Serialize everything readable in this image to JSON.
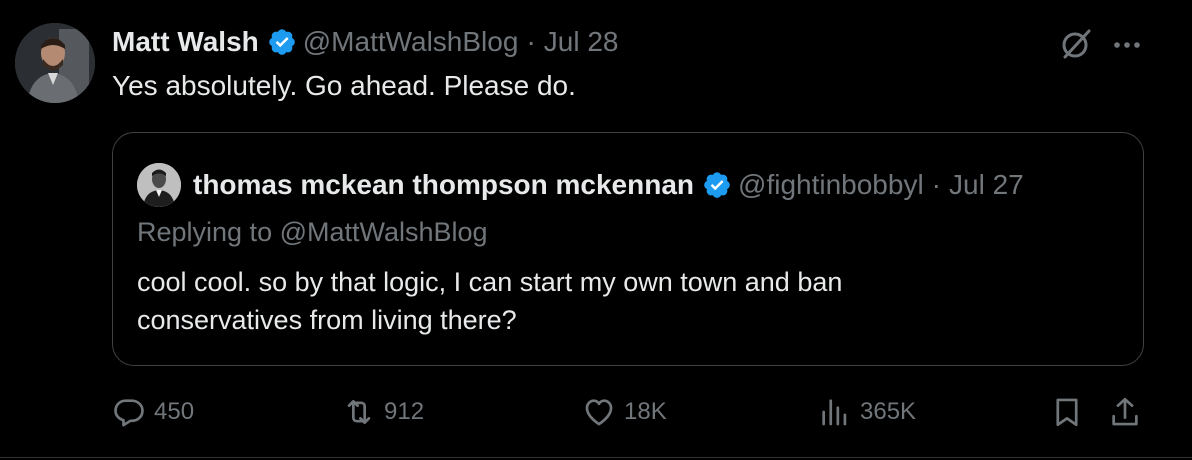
{
  "post": {
    "author_name": "Matt Walsh",
    "author_handle": "@MattWalshBlog",
    "separator": "·",
    "date": "Jul 28",
    "text": "Yes absolutely. Go ahead. Please do."
  },
  "quote": {
    "author_name": "thomas mckean thompson mckennan",
    "author_handle": "@fightinbobbyl",
    "separator": "·",
    "date": "Jul 27",
    "replying_to": "Replying to @MattWalshBlog",
    "text_lines": [
      "cool cool.  so by that logic, I can start my own town and ban",
      "conservatives from living there?"
    ]
  },
  "actions": {
    "replies": "450",
    "reposts": "912",
    "likes": "18K",
    "views": "365K"
  },
  "icons": {
    "verified": "verified-badge-icon",
    "grok": "grok-icon",
    "more": "more-icon",
    "reply": "reply-icon",
    "repost": "repost-icon",
    "like": "heart-icon",
    "views": "views-icon",
    "bookmark": "bookmark-icon",
    "share": "share-icon"
  },
  "colors": {
    "background": "#000000",
    "text": "#e7e9ea",
    "muted": "#71767b",
    "verified": "#1d9bf0",
    "border": "#3e4144"
  }
}
